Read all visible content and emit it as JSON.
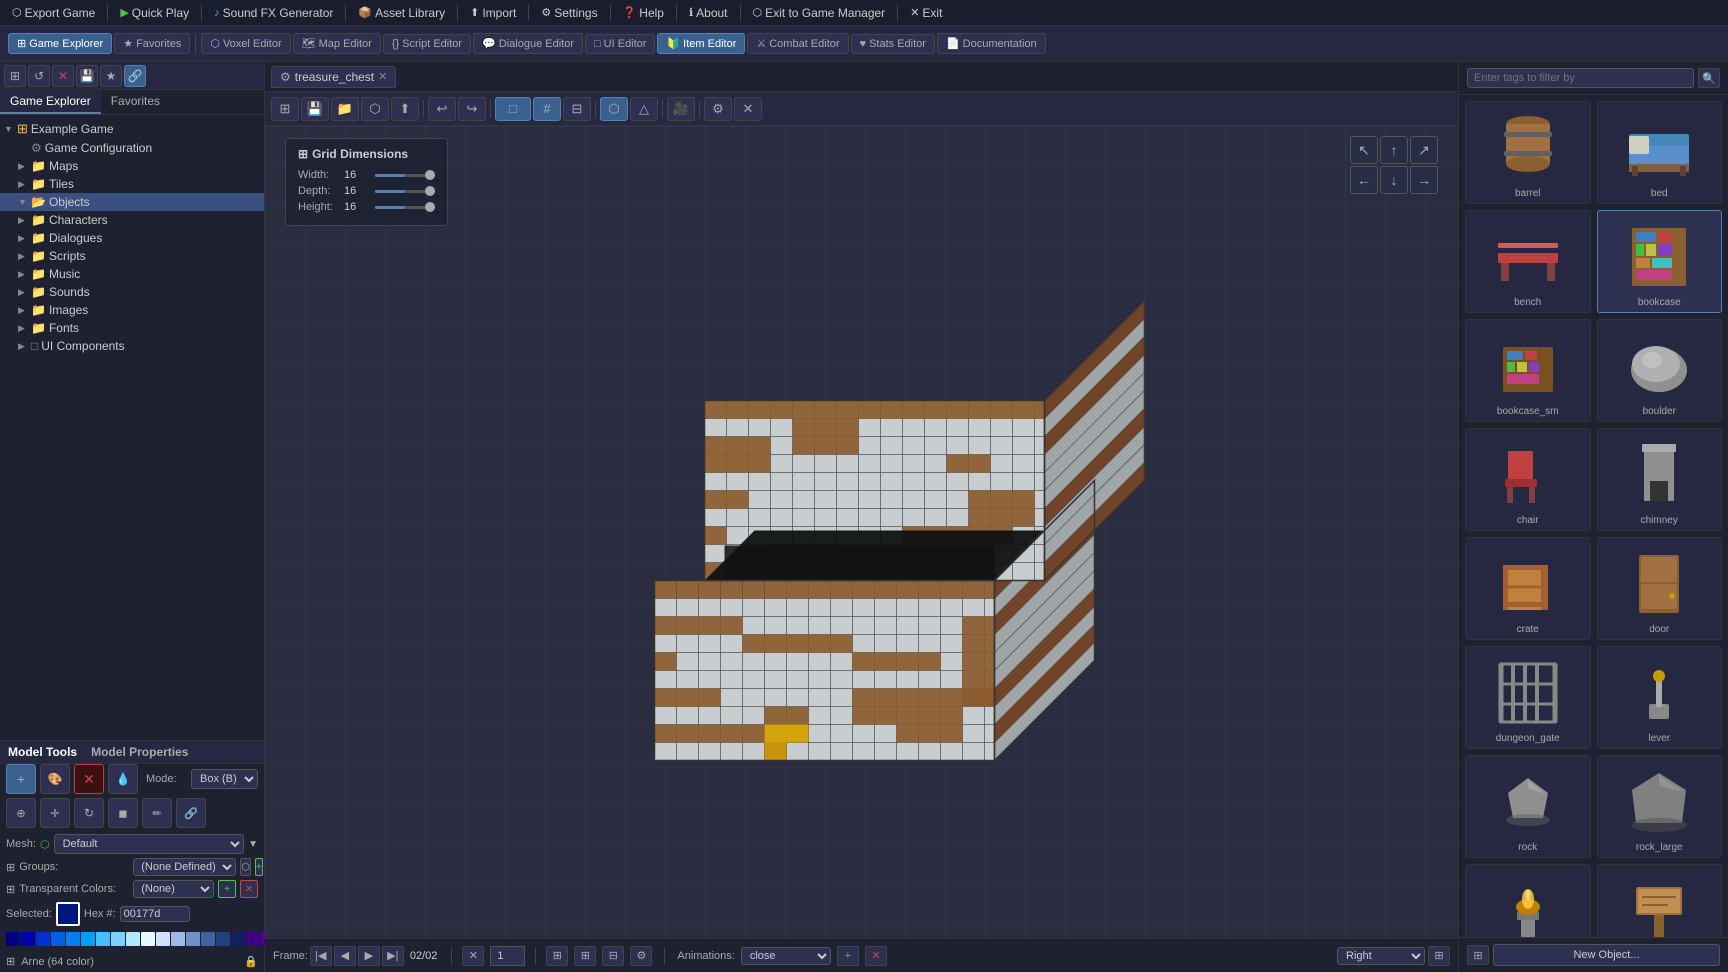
{
  "topMenu": {
    "items": [
      {
        "id": "export-game",
        "label": "Export Game",
        "icon": "⬡"
      },
      {
        "id": "quick-play",
        "label": "Quick Play",
        "icon": "▶"
      },
      {
        "id": "sound-fx",
        "label": "Sound FX Generator",
        "icon": "♪"
      },
      {
        "id": "asset-library",
        "label": "Asset Library",
        "icon": "📦"
      },
      {
        "id": "import",
        "label": "Import",
        "icon": "⬆"
      },
      {
        "id": "settings",
        "label": "Settings",
        "icon": "⚙"
      },
      {
        "id": "help",
        "label": "Help",
        "icon": "?"
      },
      {
        "id": "about",
        "label": "About",
        "icon": "ℹ"
      },
      {
        "id": "exit-manager",
        "label": "Exit to Game Manager",
        "icon": "⬡"
      },
      {
        "id": "exit",
        "label": "Exit",
        "icon": "✕"
      }
    ]
  },
  "toolbar": {
    "tabs": [
      {
        "id": "game-explorer",
        "label": "Game Explorer",
        "active": true
      },
      {
        "id": "favorites",
        "label": "Favorites",
        "active": false
      },
      {
        "id": "voxel-editor",
        "label": "Voxel Editor",
        "active": false
      },
      {
        "id": "map-editor",
        "label": "Map Editor",
        "active": false
      },
      {
        "id": "script-editor",
        "label": "Script Editor",
        "active": false
      },
      {
        "id": "dialogue-editor",
        "label": "Dialogue Editor",
        "active": false
      },
      {
        "id": "ui-editor",
        "label": "UI Editor",
        "active": false
      },
      {
        "id": "item-editor",
        "label": "Item Editor",
        "active": true
      },
      {
        "id": "combat-editor",
        "label": "Combat Editor",
        "active": false
      },
      {
        "id": "stats-editor",
        "label": "Stats Editor",
        "active": false
      },
      {
        "id": "documentation",
        "label": "Documentation",
        "active": false
      }
    ]
  },
  "gameExplorer": {
    "title": "Game Explorer",
    "tabs": [
      "Game Explorer",
      "Favorites"
    ],
    "tree": [
      {
        "id": "example-game",
        "label": "Example Game",
        "type": "root",
        "indent": 0,
        "icon": "▼"
      },
      {
        "id": "game-config",
        "label": "Game Configuration",
        "type": "item",
        "indent": 1
      },
      {
        "id": "maps",
        "label": "Maps",
        "type": "folder",
        "indent": 1,
        "icon": "▶"
      },
      {
        "id": "tiles",
        "label": "Tiles",
        "type": "folder",
        "indent": 1,
        "icon": "▶"
      },
      {
        "id": "objects",
        "label": "Objects",
        "type": "folder",
        "indent": 1,
        "icon": "▼",
        "selected": true
      },
      {
        "id": "characters",
        "label": "Characters",
        "type": "folder",
        "indent": 1,
        "icon": "▶"
      },
      {
        "id": "dialogues",
        "label": "Dialogues",
        "type": "folder",
        "indent": 1,
        "icon": "▶"
      },
      {
        "id": "scripts",
        "label": "Scripts",
        "type": "folder",
        "indent": 1,
        "icon": "▶"
      },
      {
        "id": "music",
        "label": "Music",
        "type": "folder",
        "indent": 1,
        "icon": "▶"
      },
      {
        "id": "sounds",
        "label": "Sounds",
        "type": "folder",
        "indent": 1,
        "icon": "▶"
      },
      {
        "id": "images",
        "label": "Images",
        "type": "folder",
        "indent": 1,
        "icon": "▶"
      },
      {
        "id": "fonts",
        "label": "Fonts",
        "type": "folder",
        "indent": 1,
        "icon": "▶"
      },
      {
        "id": "ui-components",
        "label": "UI Components",
        "type": "folder",
        "indent": 1,
        "icon": "□"
      }
    ]
  },
  "modelTools": {
    "title": "Model Tools",
    "propertiesTitle": "Model Properties",
    "modeLabel": "Mode:",
    "modeValue": "Box (B)",
    "meshLabel": "Mesh:",
    "meshValue": "Default",
    "groupsLabel": "Groups:",
    "groupsValue": "(None Defined)",
    "transColorsLabel": "Transparent Colors:",
    "transColorsValue": "(None)",
    "selectedLabel": "Selected:",
    "hexLabel": "Hex #:",
    "hexValue": "00177d",
    "selectedColor": "#00177d"
  },
  "viewport": {
    "tab": {
      "icon": "⚙",
      "label": "treasure_chest",
      "closeable": true
    },
    "gridDims": {
      "title": "Grid Dimensions",
      "width": {
        "label": "Width:",
        "value": 16
      },
      "depth": {
        "label": "Depth:",
        "value": 16
      },
      "height": {
        "label": "Height:",
        "value": 16
      }
    },
    "bottomBar": {
      "frameLabel": "Frame:",
      "frameValue": "02/02",
      "frameInput": "1",
      "animLabel": "Animations:",
      "animValue": "close",
      "viewValue": "Right"
    }
  },
  "rightPanel": {
    "searchPlaceholder": "Enter tags to filter by",
    "newObjectLabel": "New Object...",
    "assets": [
      {
        "id": "barrel",
        "label": "barrel",
        "selected": false
      },
      {
        "id": "bed",
        "label": "bed",
        "selected": false
      },
      {
        "id": "bench",
        "label": "bench",
        "selected": false
      },
      {
        "id": "bookcase",
        "label": "bookcase",
        "selected": true
      },
      {
        "id": "bookcase_sm",
        "label": "bookcase_sm",
        "selected": false
      },
      {
        "id": "boulder",
        "label": "boulder",
        "selected": false
      },
      {
        "id": "chair",
        "label": "chair",
        "selected": false
      },
      {
        "id": "chimney",
        "label": "chimney",
        "selected": false
      },
      {
        "id": "crate",
        "label": "crate",
        "selected": false
      },
      {
        "id": "door",
        "label": "door",
        "selected": false
      },
      {
        "id": "dungeon_gate",
        "label": "dungeon_gate",
        "selected": false
      },
      {
        "id": "lever",
        "label": "lever",
        "selected": false
      },
      {
        "id": "rock",
        "label": "rock",
        "selected": false
      },
      {
        "id": "rock_large",
        "label": "rock_large",
        "selected": false
      },
      {
        "id": "sconce",
        "label": "sconce",
        "selected": false
      },
      {
        "id": "sign",
        "label": "sign",
        "selected": false
      }
    ]
  },
  "colorPalette": {
    "colors": [
      [
        "#000080",
        "#0000b0",
        "#0030d0",
        "#0060e0",
        "#0080f0",
        "#00a0f8",
        "#40c0ff",
        "#80d0ff",
        "#b0e8ff",
        "#ffffff",
        "#e0e0e0",
        "#c0c0c0",
        "#909090",
        "#606060",
        "#303030",
        "#000000"
      ],
      [
        "#600080",
        "#8000a0",
        "#a000c0",
        "#c000d0",
        "#d040e0",
        "#e060f0",
        "#e880f8",
        "#f0a0ff",
        "#f8c8ff",
        "#ffffff",
        "#ffe8f8",
        "#ffc0f0",
        "#ff90e8",
        "#e060c0",
        "#a03090",
        "#600060"
      ],
      [
        "#800040",
        "#a00060",
        "#c00080",
        "#d000a0",
        "#e020b0",
        "#f040c0",
        "#f870d0",
        "#ffa0e0",
        "#ffc8f0",
        "#ffffff",
        "#fff0f8",
        "#ffd8f0",
        "#ffb0e8",
        "#ff80d0",
        "#d040a0",
        "#900060"
      ],
      [
        "#800000",
        "#a01000",
        "#c02000",
        "#d04000",
        "#e06000",
        "#f08000",
        "#f8a000",
        "#ffc040",
        "#ffe080",
        "#ffffff",
        "#fff8d0",
        "#fff0a0",
        "#ffe060",
        "#ffc000",
        "#e08000",
        "#b04000"
      ],
      [
        "#400000",
        "#600000",
        "#800000",
        "#a01010",
        "#c02020",
        "#d04040",
        "#e06060",
        "#f08080",
        "#f8a0a0",
        "#ffffff",
        "#ffe8e8",
        "#ffc0c0",
        "#ff9090",
        "#f06060",
        "#c03030",
        "#800000"
      ],
      [
        "#004000",
        "#006000",
        "#008000",
        "#00a010",
        "#20c020",
        "#40d040",
        "#60e060",
        "#80f080",
        "#a8ffa8",
        "#ffffff",
        "#e8ffe8",
        "#c0ffc0",
        "#90ff90",
        "#60f060",
        "#30c030",
        "#008000"
      ],
      [
        "#003000",
        "#004800",
        "#006000",
        "#108000",
        "#20a020",
        "#40b840",
        "#60d060",
        "#80e880",
        "#a8ffa8",
        "#f0fff0",
        "#c8ffc8",
        "#a0ffa0",
        "#78ff78",
        "#50e850",
        "#28c028",
        "#008800"
      ],
      [
        "#006040",
        "#008060",
        "#00a080",
        "#00c090",
        "#00d0a0",
        "#20e0b0",
        "#40f0c0",
        "#70f8d0",
        "#a8ffe8",
        "#ffffff",
        "#e0fff8",
        "#b8fff0",
        "#88ffe8",
        "#50f0d0",
        "#18d0a8",
        "#008878"
      ],
      [
        "#006080",
        "#0080a0",
        "#00a0c0",
        "#00b8d8",
        "#00c8e8",
        "#20d8f0",
        "#50e8f8",
        "#88f0ff",
        "#b8f8ff",
        "#ffffff",
        "#e0f8ff",
        "#b8f0ff",
        "#88e8ff",
        "#50d8ff",
        "#18b8f0",
        "#0080b0"
      ],
      [
        "#400080",
        "#5000a0",
        "#7000c0",
        "#8800d8",
        "#a020e8",
        "#b840f0",
        "#d070f8",
        "#e0a0ff",
        "#f0c8ff",
        "#ffffff",
        "#f0e0ff",
        "#e0c0ff",
        "#c890ff",
        "#a860f0",
        "#8030c0",
        "#500090"
      ]
    ]
  }
}
